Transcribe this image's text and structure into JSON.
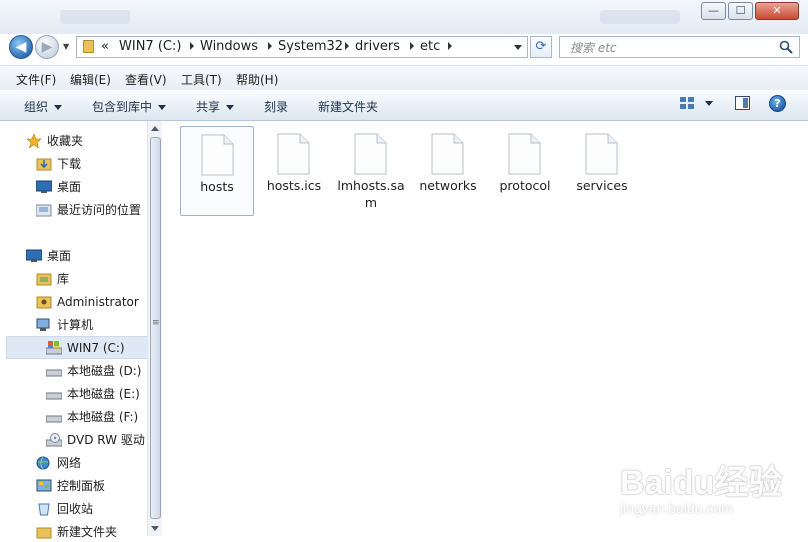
{
  "window": {
    "minimize": "—",
    "maximize": "☐",
    "close": "✕"
  },
  "address": {
    "overflow": "«",
    "crumbs": [
      "WIN7 (C:)",
      "Windows",
      "System32",
      "drivers",
      "etc"
    ]
  },
  "search": {
    "placeholder": "搜索 etc"
  },
  "menu": [
    "文件(F)",
    "编辑(E)",
    "查看(V)",
    "工具(T)",
    "帮助(H)"
  ],
  "commands": {
    "organize": "组织",
    "include_in_library": "包含到库中",
    "share": "共享",
    "burn": "刻录",
    "new_folder": "新建文件夹"
  },
  "nav": {
    "favorites": "收藏夹",
    "downloads": "下载",
    "desktop_fav": "桌面",
    "recent": "最近访问的位置",
    "desktop": "桌面",
    "libraries": "库",
    "administrator": "Administrator",
    "computer": "计算机",
    "drive_c": "WIN7 (C:)",
    "drive_d": "本地磁盘 (D:)",
    "drive_e": "本地磁盘 (E:)",
    "drive_f": "本地磁盘 (F:)",
    "dvd": "DVD RW 驱动",
    "network": "网络",
    "control_panel": "控制面板",
    "recycle_bin": "回收站",
    "new_folder": "新建文件夹"
  },
  "files": [
    {
      "name": "hosts",
      "selected": true
    },
    {
      "name": "hosts.ics"
    },
    {
      "name": "lmhosts.sam"
    },
    {
      "name": "networks"
    },
    {
      "name": "protocol"
    },
    {
      "name": "services"
    }
  ],
  "watermark": {
    "brand": "Baidu经验",
    "url": "jingyan.baidu.com"
  },
  "colors": {
    "accent": "#2d6eb5",
    "selection": "#dfe9f6",
    "folder": "#e8c25a"
  }
}
